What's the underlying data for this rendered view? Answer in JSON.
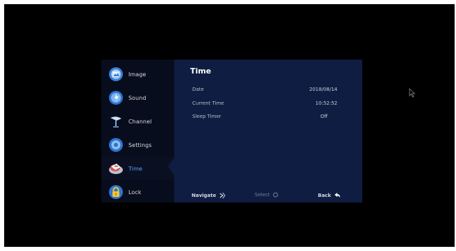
{
  "menu": {
    "items": [
      {
        "label": "Image",
        "icon": "image-icon"
      },
      {
        "label": "Sound",
        "icon": "sound-icon"
      },
      {
        "label": "Channel",
        "icon": "antenna-icon"
      },
      {
        "label": "Settings",
        "icon": "settings-icon"
      },
      {
        "label": "Time",
        "icon": "time-icon",
        "active": true
      },
      {
        "label": "Lock",
        "icon": "lock-icon"
      }
    ]
  },
  "panel": {
    "title": "Time",
    "rows": [
      {
        "label": "Date",
        "value": "2018/08/14"
      },
      {
        "label": "Current Time",
        "value": "10:52:52"
      },
      {
        "label": "Sleep Timer",
        "value": "Off"
      }
    ]
  },
  "hints": {
    "navigate": "Navigate",
    "select": "Select",
    "back": "Back"
  },
  "colors": {
    "accent": "#5aa6ff",
    "panel_bg": "#0f1d42",
    "menu_bg": "#070d1c",
    "screen_bg": "#000000"
  }
}
